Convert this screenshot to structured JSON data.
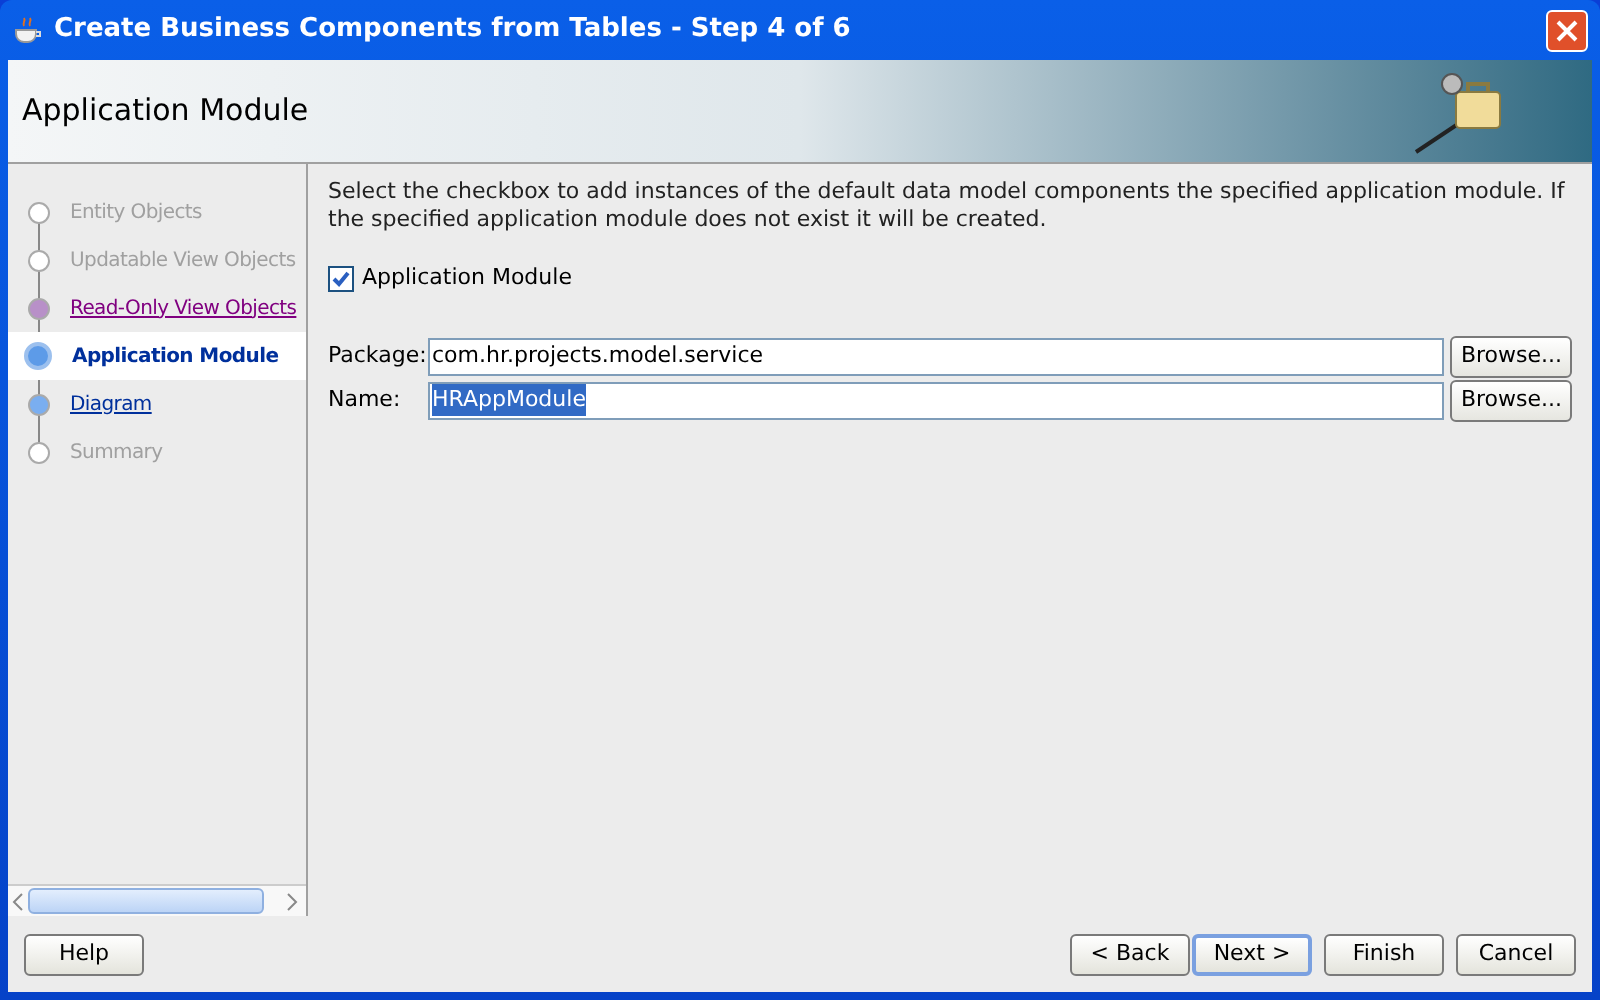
{
  "window": {
    "title": "Create Business Components from Tables - Step 4 of 6"
  },
  "header": {
    "title": "Application Module"
  },
  "steps": [
    {
      "label": "Entity Objects",
      "kind": "disabled",
      "selected": false
    },
    {
      "label": "Updatable View Objects",
      "kind": "disabled",
      "selected": false
    },
    {
      "label": "Read-Only View Objects",
      "kind": "visited",
      "selected": false
    },
    {
      "label": "Application Module",
      "selected": true
    },
    {
      "label": "Diagram",
      "kind": "link",
      "selected": false
    },
    {
      "label": "Summary",
      "kind": "disabled",
      "selected": false
    }
  ],
  "instructions": "Select the checkbox to add instances of the default data model components the specified application module.  If the specified application module does not exist it will be created.",
  "checkbox": {
    "label": "Application Module",
    "checked": true
  },
  "fields": [
    {
      "label": "Package:",
      "value": "com.hr.projects.model.service",
      "value_selected": false,
      "button": "Browse..."
    },
    {
      "label": "Name:",
      "value": "HRAppModule",
      "value_selected": true,
      "button": "Browse..."
    }
  ],
  "buttons_left": [
    "Help"
  ],
  "buttons_right": [
    {
      "label": "< Back",
      "default": false
    },
    {
      "label": "Next >",
      "default": true
    },
    {
      "label": "Finish",
      "default": false
    },
    {
      "label": "Cancel",
      "default": false
    }
  ]
}
